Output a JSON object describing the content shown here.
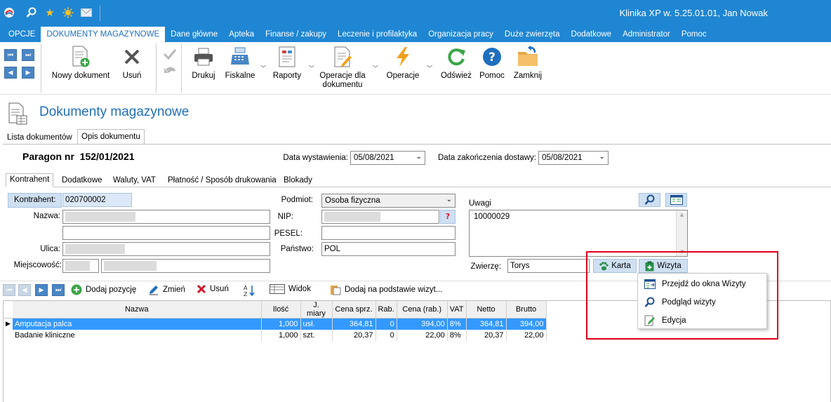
{
  "app": {
    "title": "Klinika XP w. 5.25.01.01, Jan Nowak"
  },
  "menu": [
    "OPCJE",
    "DOKUMENTY MAGAZYNOWE",
    "Dane główne",
    "Apteka",
    "Finanse / zakupy",
    "Leczenie i profilaktyka",
    "Organizacja pracy",
    "Duże zwierzęta",
    "Dodatkowe",
    "Administrator",
    "Pomoc"
  ],
  "toolbar": {
    "new_doc": "Nowy dokument",
    "delete": "Usuń",
    "print": "Drukuj",
    "fiscal": "Fiskalne",
    "reports": "Raporty",
    "doc_ops_1": "Operacje dla",
    "doc_ops_2": "dokumentu",
    "ops": "Operacje",
    "refresh": "Odśwież",
    "help": "Pomoc",
    "close": "Zamknij"
  },
  "page": {
    "title": "Dokumenty magazynowe"
  },
  "tabs": [
    "Lista dokumentów",
    "Opis dokumentu"
  ],
  "doc": {
    "number": "Paragon nr  152/01/2021",
    "issue_label": "Data wystawienia:",
    "issue_date": "05/08/2021",
    "delivery_label": "Data zakończenia dostawy:",
    "delivery_date": "05/08/2021"
  },
  "subtabs": [
    "Kontrahent",
    "Dodatkowe",
    "Waluty, VAT",
    "Płatność / Sposób drukowania",
    "Blokady"
  ],
  "form": {
    "contractor_label": "Kontrahent:",
    "contractor_value": "020700002",
    "name_label": "Nazwa:",
    "street_label": "Ulica:",
    "city_label": "Miejscowość:",
    "subject_label": "Podmiot:",
    "subject_value": "Osoba fizyczna",
    "nip_label": "NIP:",
    "pesel_label": "PESEL:",
    "country_label": "Państwo:",
    "country_value": "POL",
    "notes_label": "Uwagi",
    "notes_value": "10000029",
    "animal_label": "Zwierzę:",
    "animal_value": "Torys",
    "card_btn": "Karta",
    "visit_btn": "Wizyta"
  },
  "gridbar": {
    "add": "Dodaj pozycję",
    "edit": "Zmień",
    "delete": "Usuń",
    "view": "Widok",
    "add_from_visit": "Dodaj na podstawie wizyt..."
  },
  "table": {
    "columns": [
      "Nazwa",
      "Ilość",
      "J. miary",
      "Cena sprz.",
      "Rab.",
      "Cena (rab.)",
      "VAT",
      "Netto",
      "Brutto"
    ],
    "rows": [
      [
        "Amputacja palca",
        "1,000",
        "usł.",
        "364,81",
        "0",
        "394,00",
        "8%",
        "364,81",
        "394,00"
      ],
      [
        "Badanie kliniczne",
        "1,000",
        "szt.",
        "20,37",
        "0",
        "22,00",
        "8%",
        "20,37",
        "22,00"
      ]
    ]
  },
  "context_menu": [
    "Przejdź do okna Wizyty",
    "Podgląd wizyty",
    "Edycja"
  ],
  "colors": {
    "accent": "#1f86d3",
    "highlight": "#e0001b",
    "selection": "#3399ff"
  }
}
